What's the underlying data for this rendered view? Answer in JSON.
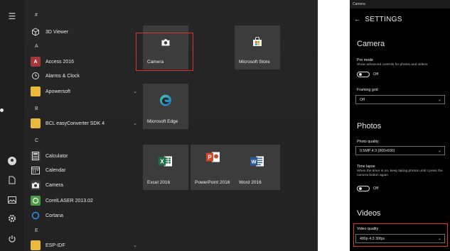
{
  "start_menu": {
    "letters": [
      "#",
      "A",
      "B",
      "C",
      "E"
    ],
    "apps": [
      {
        "label": "3D Viewer",
        "icon": "3d-viewer-icon"
      },
      {
        "label": "Access 2016",
        "icon": "access-icon"
      },
      {
        "label": "Alarms & Clock",
        "icon": "alarm-clock-icon"
      },
      {
        "label": "Apowersoft",
        "icon": "folder-icon",
        "expandable": true
      },
      {
        "label": "BCL easyConverter SDK 4",
        "icon": "folder-icon",
        "expandable": true
      },
      {
        "label": "Calculator",
        "icon": "calculator-icon"
      },
      {
        "label": "Calendar",
        "icon": "calendar-icon"
      },
      {
        "label": "Camera",
        "icon": "camera-icon"
      },
      {
        "label": "CorelLASER 2013.02",
        "icon": "corel-icon"
      },
      {
        "label": "Cortana",
        "icon": "cortana-icon"
      },
      {
        "label": "ESP-IDF",
        "icon": "folder-icon",
        "expandable": true
      }
    ],
    "tiles": [
      {
        "label": "Camera",
        "icon": "camera-icon"
      },
      {
        "label": "Microsoft Store",
        "icon": "store-icon"
      },
      {
        "label": "Microsoft Edge",
        "icon": "edge-icon"
      },
      {
        "label": "Excel 2016",
        "icon": "excel-icon"
      },
      {
        "label": "PowerPoint 2016",
        "icon": "powerpoint-icon"
      },
      {
        "label": "Word 2016",
        "icon": "word-icon"
      }
    ]
  },
  "settings": {
    "window_title": "Camera",
    "header": "SETTINGS",
    "camera": {
      "title": "Camera",
      "pro_mode_label": "Pro mode",
      "pro_mode_desc": "Show advanced controls for photos and videos",
      "pro_mode_state": "Off",
      "framing_grid_label": "Framing grid",
      "framing_grid_value": "Off"
    },
    "photos": {
      "title": "Photos",
      "photo_quality_label": "Photo quality",
      "photo_quality_value": "0.5MP 4:3 (800x600)",
      "time_lapse_label": "Time lapse",
      "time_lapse_desc": "When the timer is on, keep taking photos until I press the camera button again",
      "time_lapse_state": "Off"
    },
    "videos": {
      "title": "Videos",
      "video_quality_label": "Video quality",
      "video_quality_value": "480p 4:3 30fps"
    }
  },
  "colors": {
    "highlight": "#e0302a",
    "tile": "#3c3c3c",
    "menu_bg": "#252525"
  }
}
